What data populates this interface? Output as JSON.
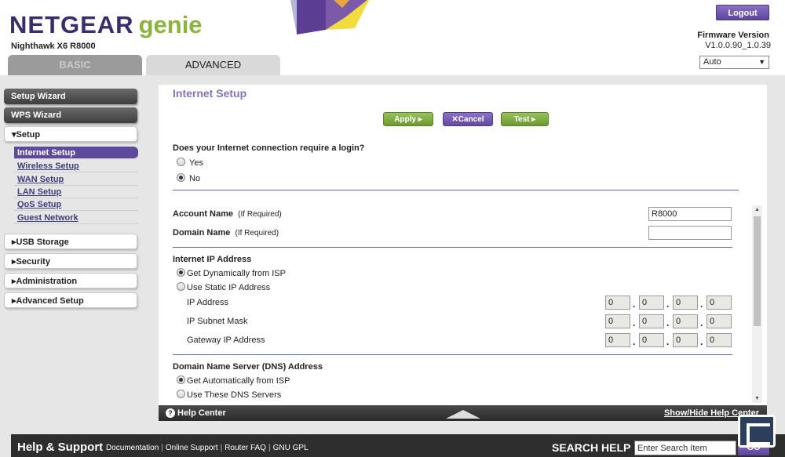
{
  "header": {
    "brand": "NETGEAR",
    "brand_suffix": "genie",
    "model": "Nighthawk X6 R8000",
    "logout_label": "Logout",
    "firmware_label": "Firmware Version",
    "firmware_value": "V1.0.0.90_1.0.39",
    "language_value": "Auto",
    "tabs": [
      {
        "label": "BASIC",
        "active": false
      },
      {
        "label": "ADVANCED",
        "active": true
      }
    ]
  },
  "sidebar": {
    "setup_wizard": "Setup Wizard",
    "wps_wizard": "WPS Wizard",
    "setup": "▾Setup",
    "setup_items": [
      "Internet Setup",
      "Wireless Setup",
      "WAN Setup",
      "LAN Setup",
      "QoS Setup",
      "Guest Network"
    ],
    "usb_storage": "▸USB Storage",
    "security": "▸Security",
    "administration": "▸Administration",
    "advanced_setup": "▸Advanced Setup"
  },
  "main": {
    "title": "Internet Setup",
    "apply_label": "Apply ▸",
    "cancel_label": "✕Cancel",
    "test_label": "Test ▸",
    "login_question": "Does your Internet connection require a login?",
    "login_yes": "Yes",
    "login_no": "No",
    "login_selected": "No",
    "account_name_label": "Account Name",
    "account_name_hint": "(If Required)",
    "account_name_value": "R8000",
    "domain_name_label": "Domain Name",
    "domain_name_hint": "(If Required)",
    "domain_name_value": "",
    "internet_ip_heading": "Internet IP Address",
    "ip_dynamic": "Get Dynamically from ISP",
    "ip_static": "Use Static IP Address",
    "ip_mode_selected": "Get Dynamically from ISP",
    "ip_address_label": "IP Address",
    "ip_address": [
      "0",
      "0",
      "0",
      "0"
    ],
    "subnet_label": "IP Subnet Mask",
    "subnet": [
      "0",
      "0",
      "0",
      "0"
    ],
    "gateway_label": "Gateway IP Address",
    "gateway": [
      "0",
      "0",
      "0",
      "0"
    ],
    "dns_heading": "Domain Name Server (DNS) Address",
    "dns_auto": "Get Automatically from ISP",
    "dns_manual": "Use These DNS Servers",
    "dns_selected": "Get Automatically from ISP"
  },
  "helpbar": {
    "help_center": "Help Center",
    "show_hide": "Show/Hide Help Center"
  },
  "footer": {
    "title": "Help & Support",
    "links": [
      "Documentation",
      "Online Support",
      "Router FAQ",
      "GNU GPL"
    ],
    "search_label": "SEARCH HELP",
    "search_placeholder": "Enter Search Item",
    "go_label": "GO"
  },
  "colors": {
    "brand_purple": "#5d4a9c",
    "brand_green": "#8ab43d",
    "title_purple": "#8474b3"
  }
}
